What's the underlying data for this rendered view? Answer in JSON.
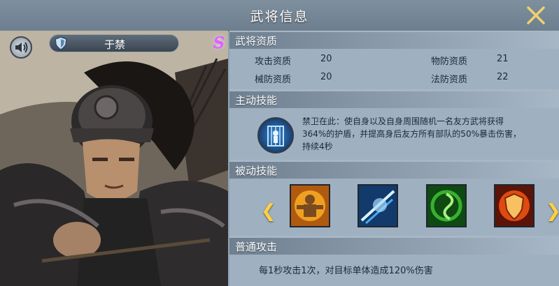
{
  "window": {
    "title": "武将信息"
  },
  "hero": {
    "name": "于禁",
    "rank": "S"
  },
  "sections": {
    "aptitude": "武将资质",
    "active": "主动技能",
    "passive": "被动技能",
    "normal": "普通攻击"
  },
  "aptitude": [
    {
      "label": "攻击资质",
      "value": "20"
    },
    {
      "label": "物防资质",
      "value": "21"
    },
    {
      "label": "械防资质",
      "value": "20"
    },
    {
      "label": "法防资质",
      "value": "22"
    }
  ],
  "active_skill": {
    "icon": "shield-guard-skill-icon",
    "lines": [
      "禁卫在此：使自身以及自身周围随机一名友方武将获得",
      "364%的护盾，并提高身后友方所有部队的50%暴击伤害，",
      "持续4秒"
    ]
  },
  "passive_skills": [
    {
      "icon": "strength-fire-skill-icon",
      "color": "#f0a020"
    },
    {
      "icon": "ice-slash-skill-icon",
      "color": "#4aa8f0"
    },
    {
      "icon": "green-swirl-skill-icon",
      "color": "#38b030"
    },
    {
      "icon": "fire-shield-skill-icon",
      "color": "#e04a10"
    }
  ],
  "normal_attack": {
    "desc": "每1秒攻击1次，对目标单体造成120%伤害"
  },
  "icons": {
    "close": "close-icon",
    "sound": "speaker-icon",
    "prev": "chevron-left-icon",
    "next": "chevron-right-icon"
  }
}
